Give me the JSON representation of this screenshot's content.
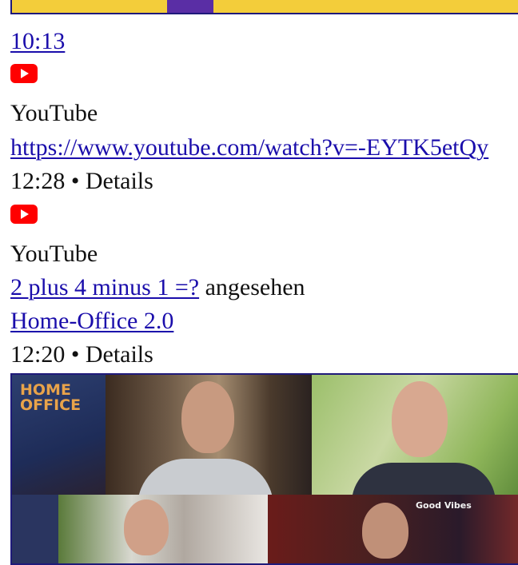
{
  "entries": [
    {
      "time": "10:13"
    },
    {
      "source": "YouTube",
      "url": "https://www.youtube.com/watch?v=-EYTK5etQy",
      "time_details": "12:28 • Details"
    },
    {
      "source": "YouTube",
      "watched_title": "2 plus 4 minus 1 =?",
      "watched_suffix": " angesehen",
      "channel": "Home-Office 2.0",
      "time_details": "12:20 • Details",
      "thumbnail": {
        "logo": "HOME\nOFFICE",
        "badge": "Good Vibes"
      }
    }
  ],
  "icons": {
    "source": "youtube-logo-icon"
  },
  "colors": {
    "link": "#1a0dab",
    "youtube_red": "#ff0000",
    "thumb_border": "#1f1a7a",
    "top_thumb": "#f3cd3a"
  }
}
